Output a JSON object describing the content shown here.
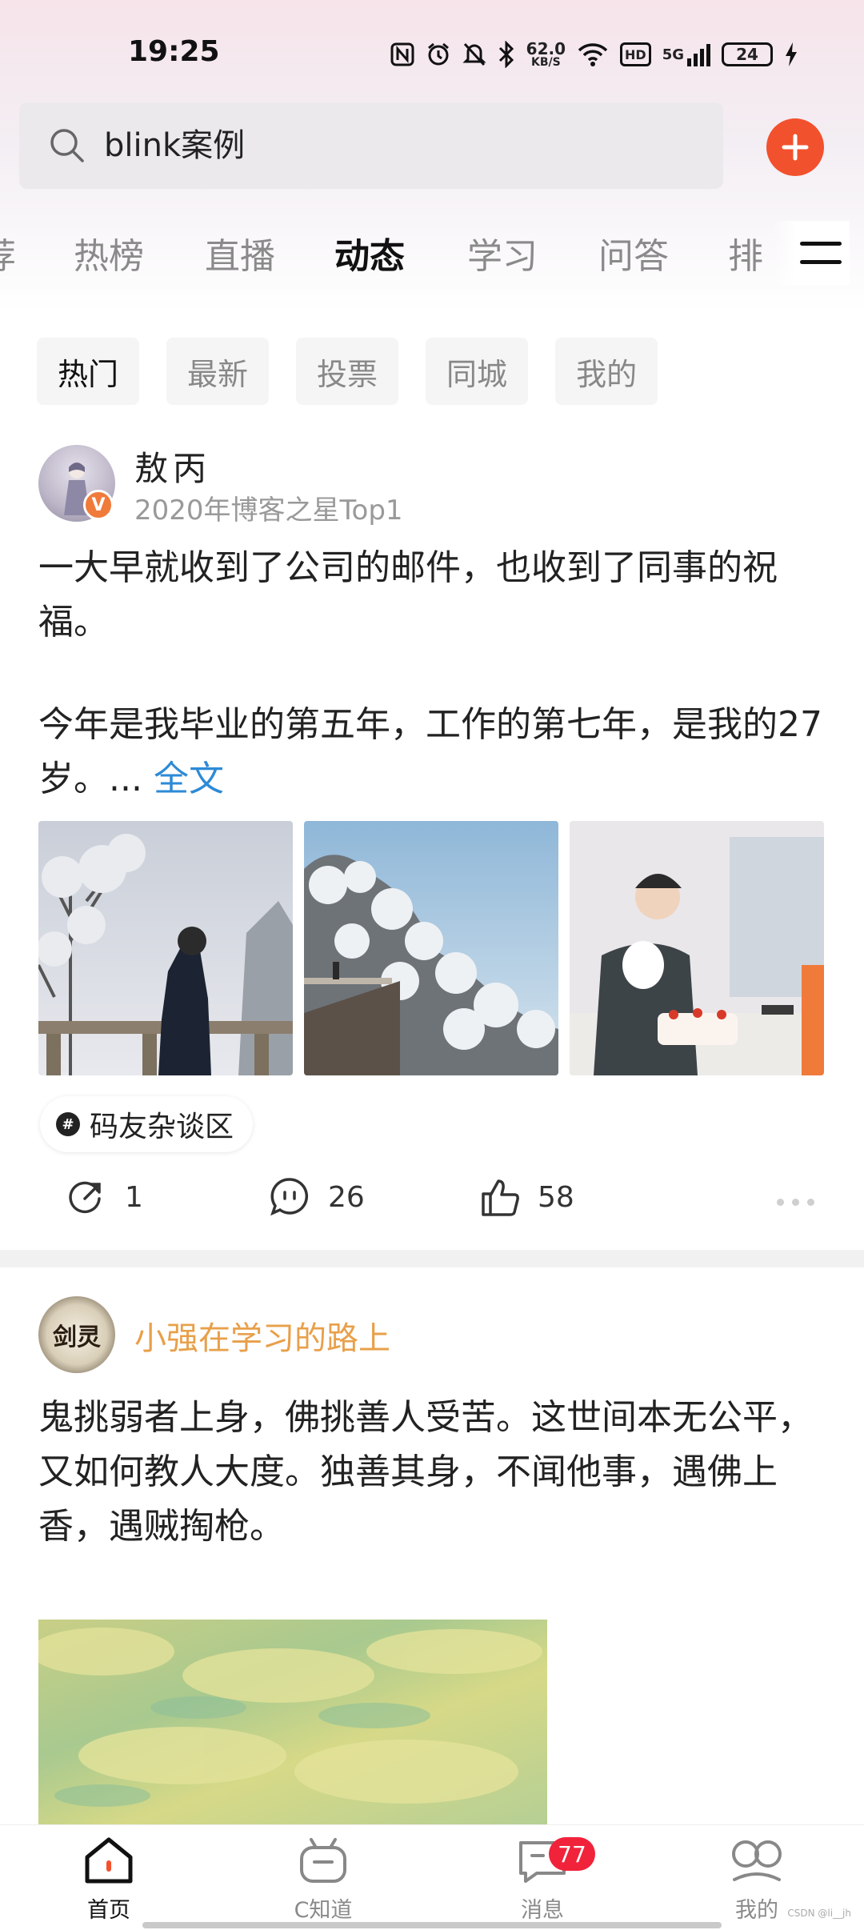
{
  "status_bar": {
    "time": "19:25",
    "net_speed_value": "62.0",
    "net_speed_unit": "KB/S",
    "hd_label": "HD",
    "network_label": "5G",
    "battery": "24",
    "icons": [
      "nfc-icon",
      "alarm-icon",
      "mute-icon",
      "bluetooth-icon",
      "wifi-icon",
      "signal-icon",
      "battery-icon",
      "charging-icon"
    ]
  },
  "search": {
    "placeholder": "blink案例"
  },
  "tabs": [
    "荐",
    "热榜",
    "直播",
    "动态",
    "学习",
    "问答",
    "排"
  ],
  "active_tab": "动态",
  "chips": [
    "热门",
    "最新",
    "投票",
    "同城",
    "我的"
  ],
  "active_chip": "热门",
  "post1": {
    "author": "敖丙",
    "subtitle": "2020年博客之星Top1",
    "verified_badge": "V",
    "text_p1": "一大早就收到了公司的邮件，也收到了同事的祝福。",
    "text_p2": "今年是我毕业的第五年，工作的第七年，是我的27岁。...",
    "more": "全文",
    "topic": "码友杂谈区",
    "share_count": "1",
    "comment_count": "26",
    "like_count": "58"
  },
  "post2": {
    "author": "小强在学习的路上",
    "avatar_text": "剑灵",
    "text": "鬼挑弱者上身，佛挑善人受苦。这世间本无公平，又如何教人大度。独善其身，不闻他事，遇佛上香，遇贼掏枪。"
  },
  "bottom_nav": {
    "home": "首页",
    "cknow": "C知道",
    "messages": "消息",
    "mine": "我的",
    "message_badge": "77"
  },
  "watermark": "CSDN @li__jh",
  "colors": {
    "accent_orange": "#f2512d",
    "link_blue": "#2d8ad6",
    "author_orange": "#e8a04a",
    "badge_red": "#f0233a"
  }
}
